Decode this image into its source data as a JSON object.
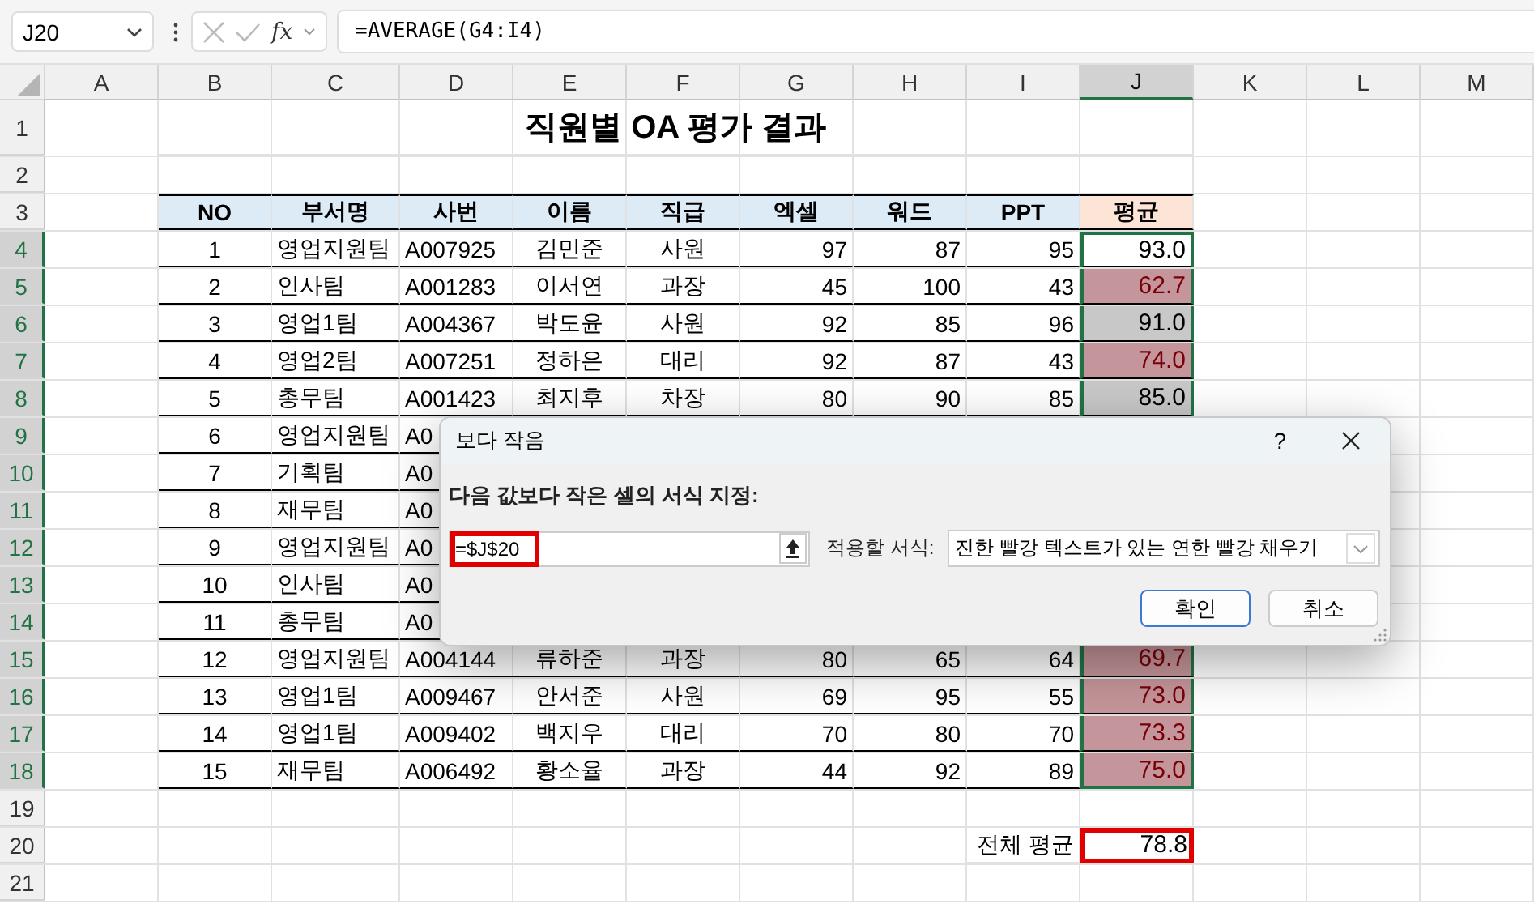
{
  "name_box": "J20",
  "formula_bar": {
    "fx": "fx",
    "formula": "=AVERAGE(G4:I4)"
  },
  "columns": [
    {
      "label": "A",
      "selected": false
    },
    {
      "label": "B",
      "selected": false
    },
    {
      "label": "C",
      "selected": false
    },
    {
      "label": "D",
      "selected": false
    },
    {
      "label": "E",
      "selected": false
    },
    {
      "label": "F",
      "selected": false
    },
    {
      "label": "G",
      "selected": false
    },
    {
      "label": "H",
      "selected": false
    },
    {
      "label": "I",
      "selected": false
    },
    {
      "label": "J",
      "selected": true
    },
    {
      "label": "K",
      "selected": false
    },
    {
      "label": "L",
      "selected": false
    },
    {
      "label": "M",
      "selected": false
    }
  ],
  "row_numbers": [
    {
      "label": "1",
      "selected": false
    },
    {
      "label": "2",
      "selected": false
    },
    {
      "label": "3",
      "selected": false
    },
    {
      "label": "4",
      "selected": true
    },
    {
      "label": "5",
      "selected": true
    },
    {
      "label": "6",
      "selected": true
    },
    {
      "label": "7",
      "selected": true
    },
    {
      "label": "8",
      "selected": true
    },
    {
      "label": "9",
      "selected": true
    },
    {
      "label": "10",
      "selected": true
    },
    {
      "label": "11",
      "selected": true
    },
    {
      "label": "12",
      "selected": true
    },
    {
      "label": "13",
      "selected": true
    },
    {
      "label": "14",
      "selected": true
    },
    {
      "label": "15",
      "selected": true
    },
    {
      "label": "16",
      "selected": true
    },
    {
      "label": "17",
      "selected": true
    },
    {
      "label": "18",
      "selected": true
    },
    {
      "label": "19",
      "selected": false
    },
    {
      "label": "20",
      "selected": false
    },
    {
      "label": "21",
      "selected": false
    }
  ],
  "title": "직원별 OA 평가 결과",
  "table": {
    "headers": [
      "NO",
      "부서명",
      "사번",
      "이름",
      "직급",
      "엑셀",
      "워드",
      "PPT"
    ],
    "avg_header": "평균",
    "rows": [
      {
        "no": "1",
        "dept": "영업지원팀",
        "id": "A007925",
        "name": "김민준",
        "rank": "사원",
        "excel": "97",
        "word": "87",
        "ppt": "95",
        "avg": "93.0",
        "conditional_fill": false,
        "shaded": false
      },
      {
        "no": "2",
        "dept": "인사팀",
        "id": "A001283",
        "name": "이서연",
        "rank": "과장",
        "excel": "45",
        "word": "100",
        "ppt": "43",
        "avg": "62.7",
        "conditional_fill": true,
        "shaded": false
      },
      {
        "no": "3",
        "dept": "영업1팀",
        "id": "A004367",
        "name": "박도윤",
        "rank": "사원",
        "excel": "92",
        "word": "85",
        "ppt": "96",
        "avg": "91.0",
        "conditional_fill": false,
        "shaded": true
      },
      {
        "no": "4",
        "dept": "영업2팀",
        "id": "A007251",
        "name": "정하은",
        "rank": "대리",
        "excel": "92",
        "word": "87",
        "ppt": "43",
        "avg": "74.0",
        "conditional_fill": true,
        "shaded": false
      },
      {
        "no": "5",
        "dept": "총무팀",
        "id": "A001423",
        "name": "최지후",
        "rank": "차장",
        "excel": "80",
        "word": "90",
        "ppt": "85",
        "avg": "85.0",
        "conditional_fill": false,
        "shaded": true
      },
      {
        "no": "6",
        "dept": "영업지원팀",
        "id": "A0"
      },
      {
        "no": "7",
        "dept": "기획팀",
        "id": "A0"
      },
      {
        "no": "8",
        "dept": "재무팀",
        "id": "A0"
      },
      {
        "no": "9",
        "dept": "영업지원팀",
        "id": "A0"
      },
      {
        "no": "10",
        "dept": "인사팀",
        "id": "A0"
      },
      {
        "no": "11",
        "dept": "총무팀",
        "id": "A0"
      },
      {
        "no": "12",
        "dept": "영업지원팀",
        "id": "A004144",
        "name": "류하준",
        "rank": "과장",
        "excel": "80",
        "word": "65",
        "ppt": "64",
        "avg": "69.7",
        "conditional_fill": true,
        "shaded": false
      },
      {
        "no": "13",
        "dept": "영업1팀",
        "id": "A009467",
        "name": "안서준",
        "rank": "사원",
        "excel": "69",
        "word": "95",
        "ppt": "55",
        "avg": "73.0",
        "conditional_fill": true,
        "shaded": false
      },
      {
        "no": "14",
        "dept": "영업1팀",
        "id": "A009402",
        "name": "백지우",
        "rank": "대리",
        "excel": "70",
        "word": "80",
        "ppt": "70",
        "avg": "73.3",
        "conditional_fill": true,
        "shaded": false
      },
      {
        "no": "15",
        "dept": "재무팀",
        "id": "A006492",
        "name": "황소율",
        "rank": "과장",
        "excel": "44",
        "word": "92",
        "ppt": "89",
        "avg": "75.0",
        "conditional_fill": true,
        "shaded": false
      }
    ]
  },
  "summary": {
    "label": "전체 평균",
    "value": "78.8",
    "highlighted": true
  },
  "dialog": {
    "title": "보다 작음",
    "help": "?",
    "prompt": "다음 값보다 작은 셀의 서식 지정:",
    "input": {
      "value": "=$J$20",
      "highlighted": true
    },
    "format_label": "적용할 서식:",
    "format_value": "진한 빨강 텍스트가 있는 연한 빨강 채우기",
    "buttons": [
      {
        "label": "확인",
        "default": true
      },
      {
        "label": "취소",
        "default": false
      }
    ]
  }
}
